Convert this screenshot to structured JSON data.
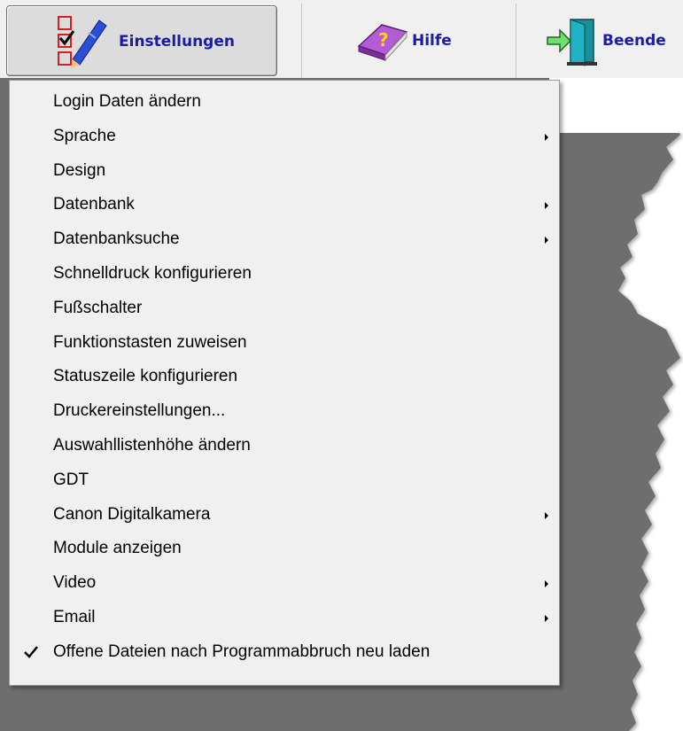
{
  "toolbar": {
    "settings_label": "Einstellungen",
    "help_label": "Hilfe",
    "exit_label": "Beende"
  },
  "menu": {
    "items": [
      {
        "label": "Login Daten ändern",
        "submenu": false
      },
      {
        "label": "Sprache",
        "submenu": true
      },
      {
        "label": "Design",
        "submenu": false
      },
      {
        "label": "Datenbank",
        "submenu": true
      },
      {
        "label": "Datenbanksuche",
        "submenu": true
      },
      {
        "label": "Schnelldruck konfigurieren",
        "submenu": false
      },
      {
        "label": "Fußschalter",
        "submenu": false
      },
      {
        "label": "Funktionstasten zuweisen",
        "submenu": false
      },
      {
        "label": "Statuszeile konfigurieren",
        "submenu": false
      },
      {
        "label": "Druckereinstellungen...",
        "submenu": false
      },
      {
        "label": "Auswahllistenhöhe ändern",
        "submenu": false
      },
      {
        "label": "GDT",
        "submenu": false
      },
      {
        "label": "Canon Digitalkamera",
        "submenu": true
      },
      {
        "label": "Module anzeigen",
        "submenu": false
      },
      {
        "label": "Video",
        "submenu": true
      },
      {
        "label": "Email",
        "submenu": true
      },
      {
        "label": "Offene Dateien nach Programmabbruch neu laden",
        "submenu": false,
        "checked": true
      }
    ]
  },
  "colors": {
    "workspace": "#6e6e6e",
    "menu_bg": "#f0f0f0",
    "toolbar_text": "#1b1ba8"
  },
  "icons": {
    "settings": "checklist-pencil-icon",
    "help": "help-book-icon",
    "exit": "exit-door-icon",
    "submenu": "submenu-arrow-icon",
    "checked": "checkmark-icon"
  }
}
